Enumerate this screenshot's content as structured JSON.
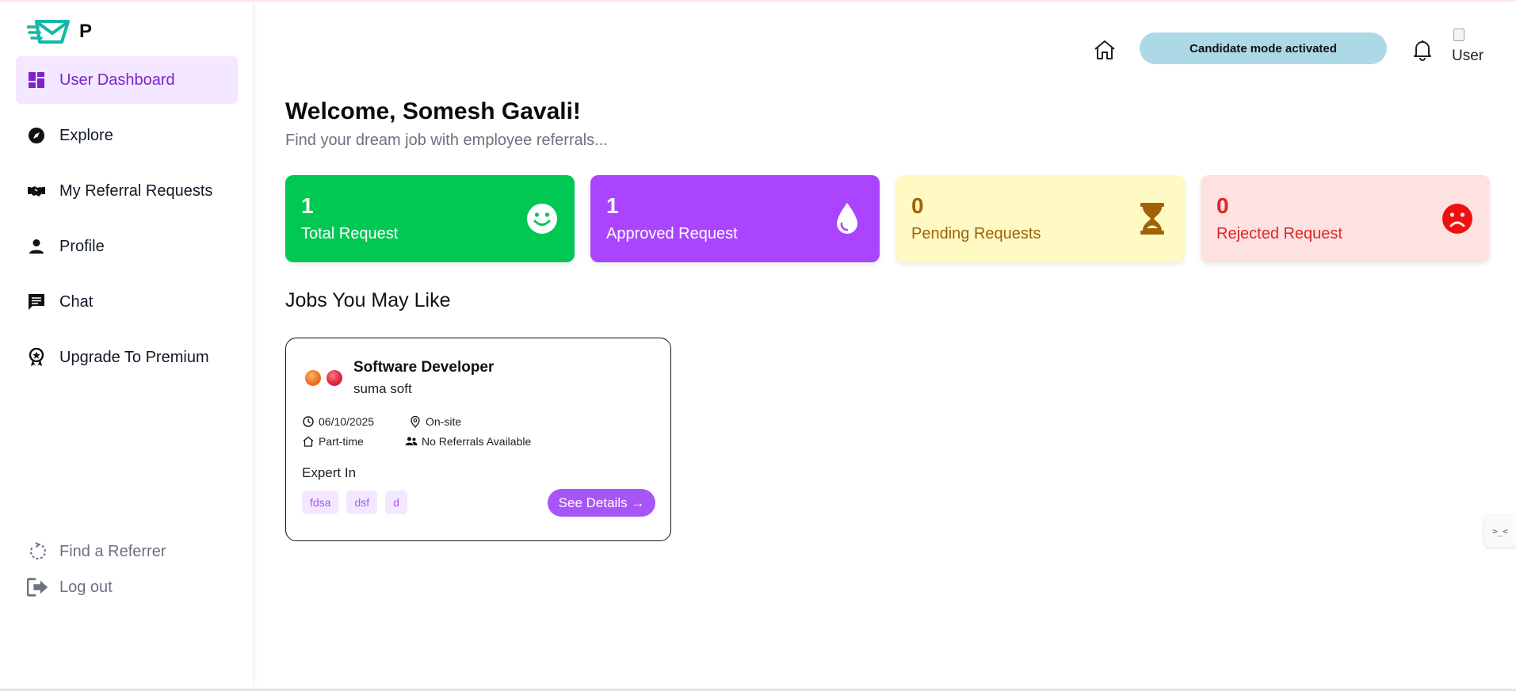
{
  "logo": {
    "letter": "P"
  },
  "sidebar": {
    "items": [
      {
        "label": "User Dashboard",
        "icon": "dashboard-icon",
        "active": true
      },
      {
        "label": "Explore",
        "icon": "compass-icon"
      },
      {
        "label": "My Referral Requests",
        "icon": "handshake-icon"
      },
      {
        "label": "Profile",
        "icon": "person-icon"
      },
      {
        "label": "Chat",
        "icon": "chat-icon"
      },
      {
        "label": "Upgrade To Premium",
        "icon": "award-icon"
      }
    ],
    "bottom": [
      {
        "label": "Find a Referrer",
        "icon": "refresh-icon"
      },
      {
        "label": "Log out",
        "icon": "logout-icon"
      }
    ]
  },
  "header": {
    "mode_label": "Candidate mode activated",
    "avatar_alt": "User"
  },
  "main": {
    "welcome": "Welcome, Somesh Gavali!",
    "subtitle": "Find your dream job with employee referrals...",
    "stats": [
      {
        "value": "1",
        "label": "Total Request",
        "icon": "smile-icon",
        "color": "#00c853"
      },
      {
        "value": "1",
        "label": "Approved Request",
        "icon": "drop-icon",
        "color": "#aa44ff"
      },
      {
        "value": "0",
        "label": "Pending Requests",
        "icon": "hourglass-icon",
        "color": "#fff9c4"
      },
      {
        "value": "0",
        "label": "Rejected Request",
        "icon": "sad-icon",
        "color": "#fee2e2"
      }
    ],
    "section_title": "Jobs You May Like",
    "job": {
      "title": "Software Developer",
      "company": "suma soft",
      "date": "06/10/2025",
      "location": "On-site",
      "type": "Part-time",
      "referrals": "No Referrals Available",
      "expert_label": "Expert In",
      "skills": [
        "fdsa",
        "dsf",
        "d"
      ],
      "button": "See Details →"
    }
  },
  "widget": {
    "label": ">_<"
  }
}
